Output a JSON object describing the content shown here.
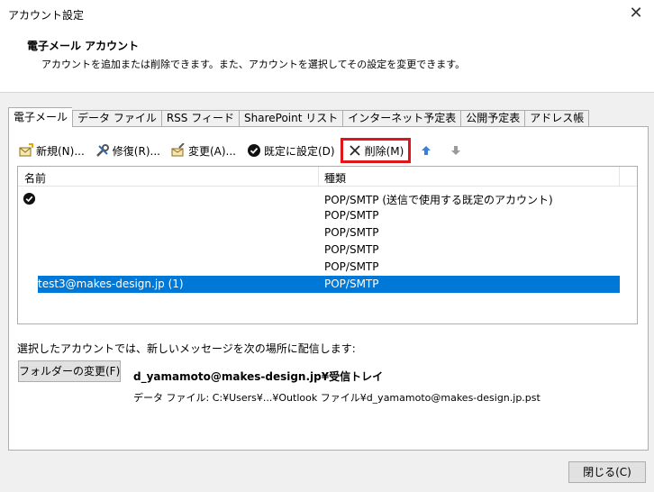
{
  "window": {
    "title": "アカウント設定",
    "close_glyph": "✕"
  },
  "header": {
    "title": "電子メール アカウント",
    "subtitle": "アカウントを追加または削除できます。また、アカウントを選択してその設定を変更できます。"
  },
  "tabs": [
    {
      "label": "電子メール",
      "active": true
    },
    {
      "label": "データ ファイル"
    },
    {
      "label": "RSS フィード"
    },
    {
      "label": "SharePoint リスト"
    },
    {
      "label": "インターネット予定表"
    },
    {
      "label": "公開予定表"
    },
    {
      "label": "アドレス帳"
    }
  ],
  "toolbar": {
    "new_label": "新規(N)...",
    "repair_label": "修復(R)...",
    "change_label": "変更(A)...",
    "default_label": "既定に設定(D)",
    "delete_label": "削除(M)",
    "highlight_color": "#e0141b"
  },
  "list": {
    "col_name": "名前",
    "col_type": "種類",
    "rows": [
      {
        "name": "",
        "type": "POP/SMTP (送信で使用する既定のアカウント)",
        "default": true
      },
      {
        "name": "",
        "type": "POP/SMTP"
      },
      {
        "name": "",
        "type": "POP/SMTP"
      },
      {
        "name": "",
        "type": "POP/SMTP"
      },
      {
        "name": "",
        "type": "POP/SMTP"
      },
      {
        "name": "test3@makes-design.jp (1)",
        "type": "POP/SMTP",
        "selected": true
      }
    ],
    "selection_color": "#0078d7"
  },
  "delivery": {
    "label": "選択したアカウントでは、新しいメッセージを次の場所に配信します:",
    "folder_button": "フォルダーの変更(F)",
    "inbox_path": "d_yamamoto@makes-design.jp¥受信トレイ",
    "data_file": "データ ファイル: C:¥Users¥...¥Outlook ファイル¥d_yamamoto@makes-design.jp.pst"
  },
  "footer": {
    "close_label": "閉じる(C)"
  }
}
